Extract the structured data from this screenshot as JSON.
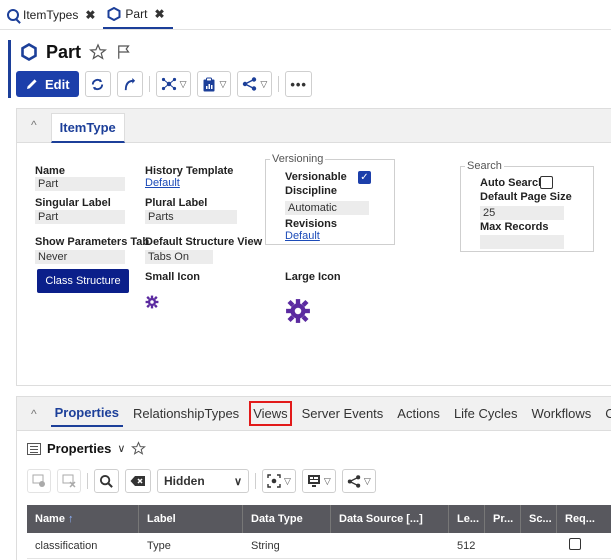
{
  "tabs": [
    {
      "label": "ItemTypes",
      "icon": "search-icon"
    },
    {
      "label": "Part",
      "icon": "hexagon-icon"
    }
  ],
  "header": {
    "title": "Part"
  },
  "toolbar": {
    "edit_label": "Edit"
  },
  "itemtype_panel": {
    "tab_label": "ItemType",
    "name_label": "Name",
    "name_value": "Part",
    "singular_label": "Singular Label",
    "singular_value": "Part",
    "show_params_label": "Show Parameters Tab",
    "show_params_value": "Never",
    "history_label": "History Template",
    "history_value": "Default",
    "plural_label": "Plural Label",
    "plural_value": "Parts",
    "default_view_label": "Default Structure View",
    "default_view_value": "Tabs On",
    "small_icon_label": "Small Icon",
    "large_icon_label": "Large Icon",
    "class_button_label": "Class Structure",
    "versioning": {
      "legend": "Versioning",
      "versionable_label": "Versionable",
      "versionable_checked": true,
      "discipline_label": "Discipline",
      "discipline_value": "Automatic",
      "revisions_label": "Revisions",
      "revisions_value": "Default"
    },
    "search": {
      "legend": "Search",
      "auto_search_label": "Auto Search",
      "auto_search_checked": false,
      "page_size_label": "Default Page Size",
      "page_size_value": "25",
      "max_records_label": "Max Records",
      "max_records_value": ""
    }
  },
  "relationship_tabs": [
    {
      "label": "Properties",
      "state": "active"
    },
    {
      "label": "RelationshipTypes",
      "state": ""
    },
    {
      "label": "Views",
      "state": "highlight"
    },
    {
      "label": "Server Events",
      "state": ""
    },
    {
      "label": "Actions",
      "state": ""
    },
    {
      "label": "Life Cycles",
      "state": ""
    },
    {
      "label": "Workflows",
      "state": ""
    },
    {
      "label": "C",
      "state": ""
    }
  ],
  "properties": {
    "title": "Properties",
    "filter_select": "Hidden"
  },
  "grid": {
    "columns": [
      "Name",
      "Label",
      "Data Type",
      "Data Source [...]",
      "Le...",
      "Pr...",
      "Sc...",
      "Req..."
    ],
    "rows": [
      [
        "classification",
        "Type",
        "String",
        "",
        "512",
        "",
        "",
        ""
      ]
    ]
  },
  "colors": {
    "accent": "#1c3f99",
    "highlight": "#e21a1a",
    "grid_header": "#58585e",
    "icon_purple": "#5b2aa0"
  }
}
